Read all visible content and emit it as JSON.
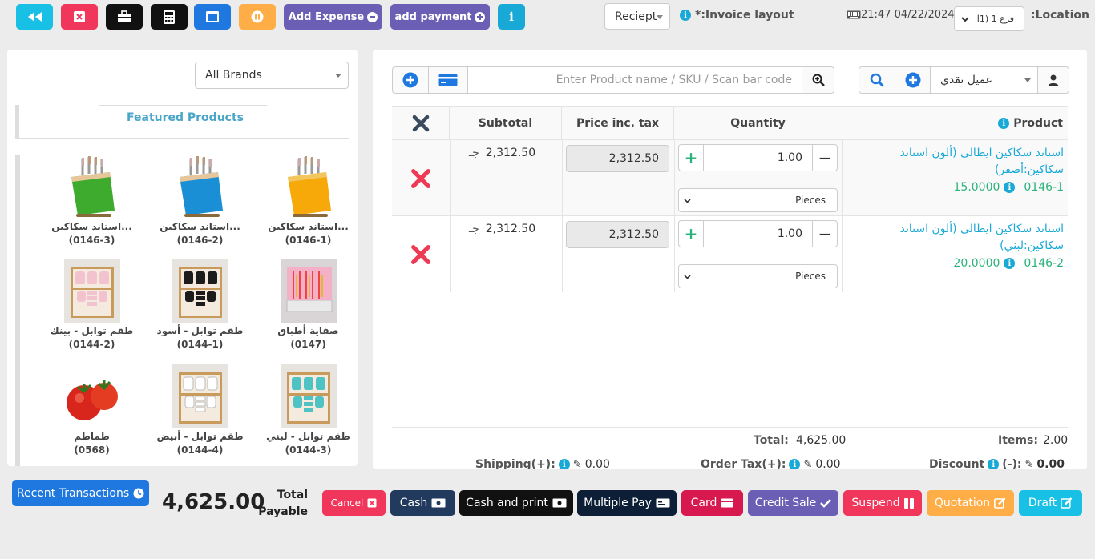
{
  "toolbar": {
    "add_expense_label": "Add Expense",
    "add_payment_label": "add payment",
    "receipt_select": "Reciept",
    "invoice_layout_label": "*:Invoice layout",
    "datetime": "21:47 04/22/2024",
    "location_label": ":Location",
    "location_value": "فرع 1 (1ا"
  },
  "left": {
    "brand_select": "All Brands",
    "featured_title": "Featured Products",
    "products": [
      {
        "name": "استاند سكاكين...",
        "sku": "(0146-1)",
        "img": "knife-orange"
      },
      {
        "name": "استاند سكاكين...",
        "sku": "(0146-2)",
        "img": "knife-blue"
      },
      {
        "name": "استاند سكاكين...",
        "sku": "(0146-3)",
        "img": "knife-green"
      },
      {
        "name": "صفاية أطباق",
        "sku": "(0147)",
        "img": "dish-rack"
      },
      {
        "name": "طقم توابل - أسود",
        "sku": "(0144-1)",
        "img": "spice-black"
      },
      {
        "name": "طقم توابل - بينك",
        "sku": "(0144-2)",
        "img": "spice-pink"
      },
      {
        "name": "طقم توابل - لبني",
        "sku": "(0144-3)",
        "img": "spice-teal"
      },
      {
        "name": "طقم توابل - أبيض",
        "sku": "(0144-4)",
        "img": "spice-white"
      },
      {
        "name": "طماطم",
        "sku": "(0568)",
        "img": "tomato"
      }
    ]
  },
  "search": {
    "placeholder": "Enter Product name / SKU / Scan bar code",
    "customer": "عميل نقدي"
  },
  "table": {
    "headers": {
      "subtotal": "Subtotal",
      "price": "Price inc. tax",
      "quantity": "Quantity",
      "product": "Product"
    },
    "rows": [
      {
        "product_name": "استاند سكاكين ايطالى (ألون استاند سكاكين:أصفر)",
        "product_sku": "0146-1",
        "stock": "15.0000",
        "quantity": "1.00",
        "unit": "Pieces",
        "price": "2,312.50",
        "subtotal": "2,312.50",
        "currency": "جـ"
      },
      {
        "product_name": "استاند سكاكين ايطالى (ألون استاند سكاكين:لبني)",
        "product_sku": "0146-2",
        "stock": "20.0000",
        "quantity": "1.00",
        "unit": "Pieces",
        "price": "2,312.50",
        "subtotal": "2,312.50",
        "currency": "جـ"
      }
    ]
  },
  "totals": {
    "total_label": "Total:",
    "total_value": "4,625.00",
    "items_label": "Items:",
    "items_value": "2.00",
    "shipping_label": "Shipping(+):",
    "shipping_value": "0.00",
    "order_tax_label": "Order Tax(+):",
    "order_tax_value": "0.00",
    "discount_label": "Discount",
    "discount_sign": "(-):",
    "discount_value": "0.00"
  },
  "footer": {
    "recent_transactions": "Recent Transactions",
    "total_payable_amount": "4,625.00",
    "total_payable_label_1": "Total",
    "total_payable_label_2": "Payable",
    "cancel": "Cancel",
    "cash": "Cash",
    "cash_and_print": "Cash and print",
    "multiple_pay": "Multiple Pay",
    "card": "Card",
    "credit_sale": "Credit Sale",
    "suspend": "Suspend",
    "quotation": "Quotation",
    "draft": "Draft"
  },
  "colors": {
    "cyan": "#19c0e6",
    "red": "#f0365a",
    "black": "#111111",
    "blue": "#1e78e0",
    "orange": "#ffad46",
    "purple": "#6b5fb5",
    "link": "#19a9d6",
    "green": "#2ab27b",
    "navy": "#213a5e",
    "darknavy": "#0c1f36"
  }
}
